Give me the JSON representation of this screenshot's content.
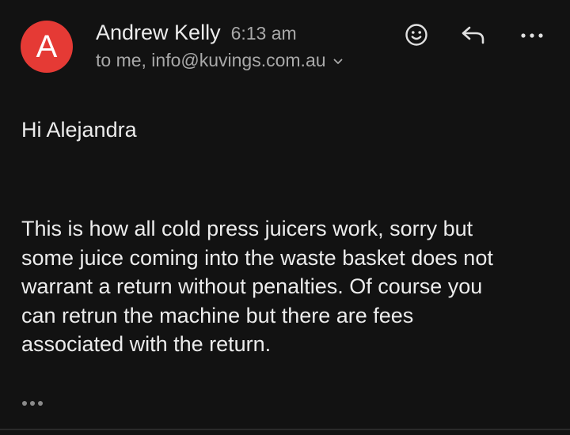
{
  "colors": {
    "background": "#121212",
    "avatar": "#e53a35",
    "primary_text": "#ececec",
    "secondary_text": "#a9a9a9"
  },
  "sender": {
    "initial": "A",
    "name": "Andrew Kelly",
    "time": "6:13 am",
    "recipients": "to me, info@kuvings.com.au"
  },
  "icons": {
    "react": "smiley-face-icon",
    "reply": "reply-arrow-icon",
    "more": "more-dots-icon",
    "details": "chevron-down-icon",
    "trimmed": "trimmed-content-dots-icon"
  },
  "message": {
    "greeting": "Hi Alejandra",
    "paragraph_lines": [
      "This is how all cold press juicers work, sorry but",
      "some juice coming into the waste basket does not",
      "warrant a return without penalties. Of course you",
      "can retrun the machine but there are fees",
      "associated with the return."
    ]
  }
}
